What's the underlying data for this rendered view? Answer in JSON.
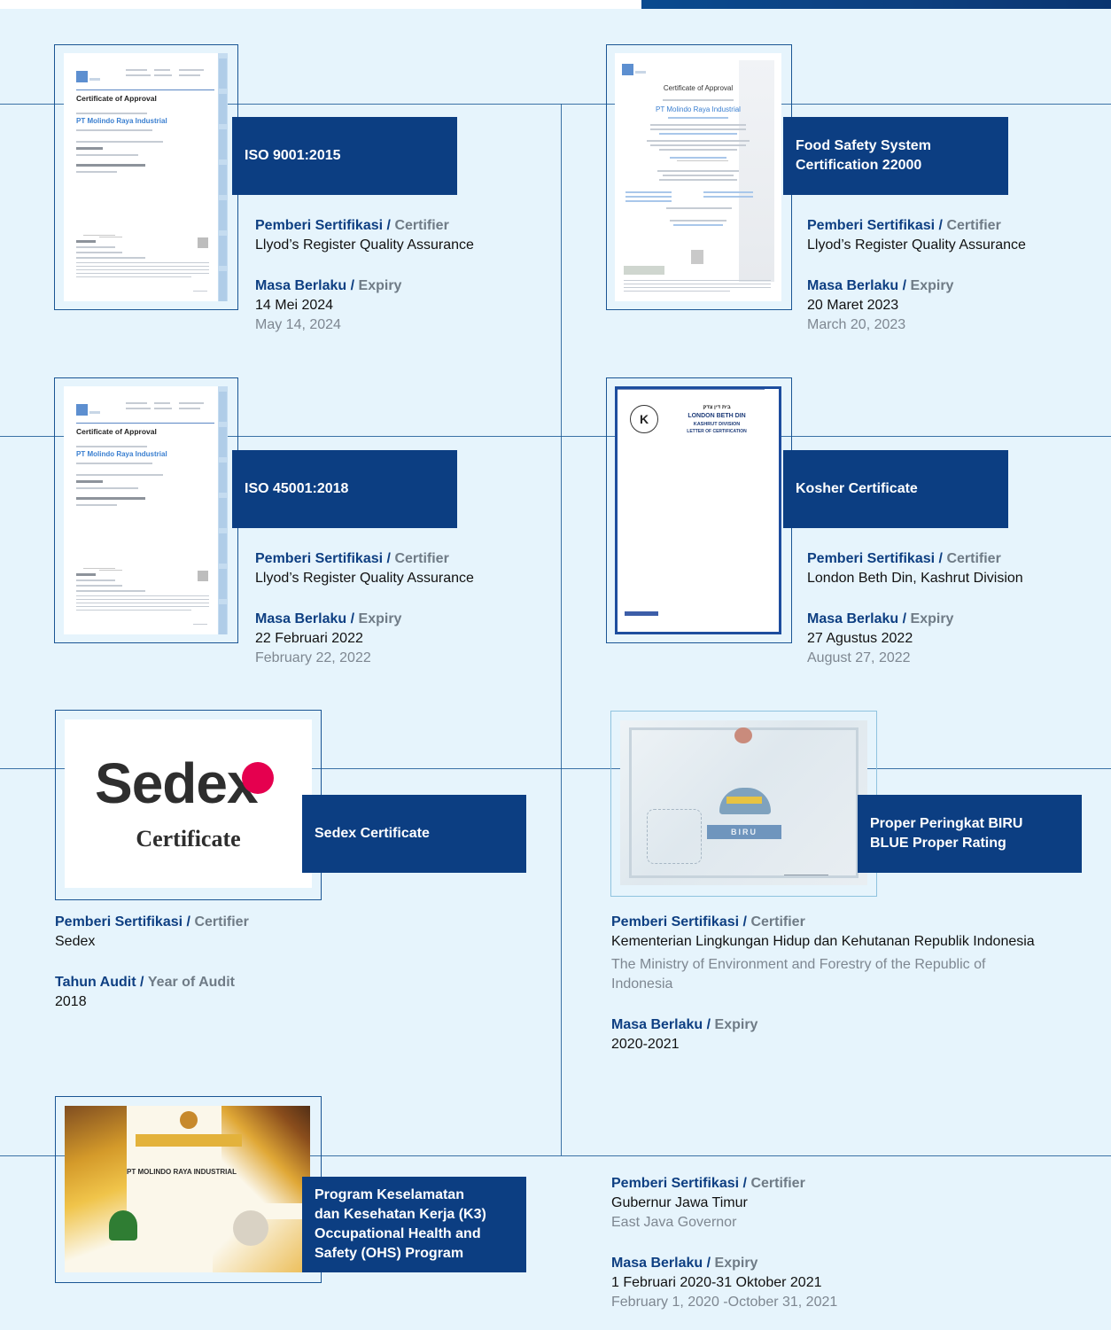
{
  "labels": {
    "certifier_id": "Pemberi Sertifikasi",
    "certifier_en": "Certifier",
    "expiry_id": "Masa Berlaku",
    "expiry_en": "Expiry",
    "audit_id": "Tahun Audit",
    "audit_en": "Year of Audit",
    "slash": "/"
  },
  "certs": [
    {
      "title": "ISO 9001:2015",
      "certifier": "Llyod’s Register Quality Assurance",
      "expiry": "14 Mei 2024",
      "expiry_en": "May 14, 2024",
      "thumb": {
        "heading": "Certificate of Approval",
        "company": "PT Molindo Raya Industrial"
      }
    },
    {
      "title_line1": "Food Safety System",
      "title_line2": "Certification 22000",
      "certifier": "Llyod’s Register Quality Assurance",
      "expiry": "20 Maret 2023",
      "expiry_en": "March 20, 2023",
      "thumb": {
        "heading": "Certificate of Approval",
        "company": "PT Molindo Raya Industrial"
      }
    },
    {
      "title": "ISO 45001:2018",
      "certifier": "Llyod’s Register Quality Assurance",
      "expiry": "22 Februari 2022",
      "expiry_en": "February 22, 2022",
      "thumb": {
        "heading": "Certificate of Approval",
        "company": "PT Molindo Raya Industrial"
      }
    },
    {
      "title": "Kosher Certificate",
      "certifier": "London Beth Din, Kashrut Division",
      "expiry": "27 Agustus 2022",
      "expiry_en": "August 27, 2022",
      "thumb": {
        "line1": "LONDON BETH DIN",
        "line2": "KASHRUT DIVISION",
        "line3": "LETTER OF CERTIFICATION"
      }
    },
    {
      "title": "Sedex Certificate",
      "certifier": "Sedex",
      "audit_year": "2018",
      "thumb": {
        "logo": "Sedex",
        "sub": "Certificate"
      }
    },
    {
      "title_line1": "Proper Peringkat BIRU",
      "title_line2": "BLUE Proper Rating",
      "certifier": "Kementerian Lingkungan Hidup dan Kehutanan Republik Indonesia",
      "certifier_en_line1": "The Ministry of Environment and Forestry of the Republic of",
      "certifier_en_line2": "Indonesia",
      "expiry": "2020-2021",
      "thumb": {
        "badge": "BIRU"
      }
    },
    {
      "title_line1": "Program Keselamatan",
      "title_line2": "dan Kesehatan Kerja (K3)",
      "title_line3": "Occupational Health and",
      "title_line4": "Safety (OHS) Program",
      "certifier": "Gubernur Jawa Timur",
      "certifier_en": "East Java Governor",
      "expiry": "1 Februari 2020-31 Oktober 2021",
      "expiry_en": "February 1, 2020 -October 31, 2021",
      "thumb": {
        "banner": "PT MOLINDO RAYA INDUSTRIAL"
      }
    }
  ],
  "colors": {
    "navy": "#0c3e82",
    "panel": "#e6f4fc",
    "muted": "#7e8791"
  }
}
